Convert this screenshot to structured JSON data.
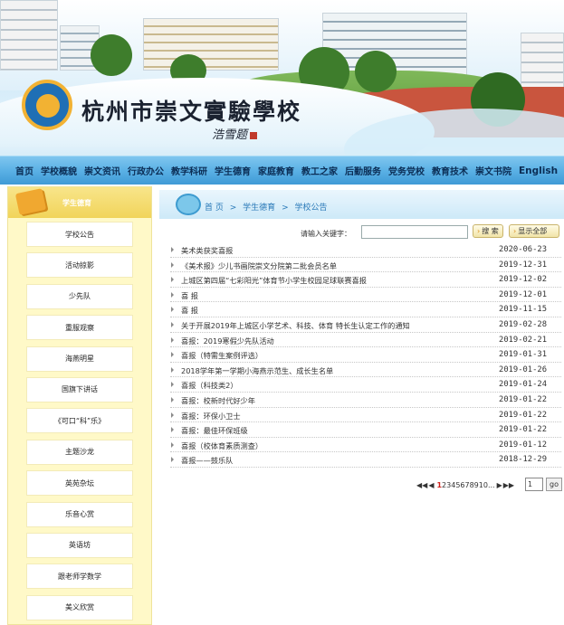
{
  "banner": {
    "school_name": "杭州市崇文實驗學校",
    "signature": "浩雪题"
  },
  "nav": {
    "items": [
      "首页",
      "学校概貌",
      "崇文资讯",
      "行政办公",
      "教学科研",
      "学生德育",
      "家庭教育",
      "教工之家",
      "后勤服务",
      "党务党校",
      "教育技术",
      "崇文书院",
      "English"
    ]
  },
  "sidebar": {
    "title": "学生德育",
    "items": [
      "学校公告",
      "活动掠影",
      "少先队",
      "重服观察",
      "海燕明星",
      "国旗下讲话",
      "《可口“科”乐》",
      "主题沙龙",
      "英苑杂坛",
      "乐音心赏",
      "英语坊",
      "跟老师学数学",
      "美义欣赏"
    ]
  },
  "breadcrumb": {
    "home": "首 页",
    "sep": ">",
    "level1": "学生德育",
    "level2": "学校公告"
  },
  "search": {
    "label": "请输入关键字：",
    "input_value": "",
    "search_button": "搜 索",
    "showall_button": "显示全部"
  },
  "news": [
    {
      "title": "美术类获奖喜报",
      "date": "2020-06-23"
    },
    {
      "title": "《美术报》少儿书画院崇文分院第二批会员名单",
      "date": "2019-12-31"
    },
    {
      "title": "上城区第四届“七彩阳光”体育节小学生校园足球联赛喜报",
      "date": "2019-12-02"
    },
    {
      "title": "喜 报",
      "date": "2019-12-01"
    },
    {
      "title": "喜 报",
      "date": "2019-11-15"
    },
    {
      "title": "关于开展2019年上城区小学艺术、科技、体育 特长生认定工作的通知",
      "date": "2019-02-28"
    },
    {
      "title": " 喜报：2019寒假少先队活动",
      "date": "2019-02-21"
    },
    {
      "title": "喜报（特需生案例评选）",
      "date": "2019-01-31"
    },
    {
      "title": "2018学年第一学期小海燕示范生、成长生名单",
      "date": "2019-01-26"
    },
    {
      "title": "喜报（科技类2）",
      "date": "2019-01-24"
    },
    {
      "title": "喜报：校新时代好少年",
      "date": "2019-01-22"
    },
    {
      "title": "喜报：环保小卫士",
      "date": "2019-01-22"
    },
    {
      "title": "喜报：最佳环保班级",
      "date": "2019-01-22"
    },
    {
      "title": "喜报（校体育素质测查）",
      "date": "2019-01-12"
    },
    {
      "title": "喜报——鼓乐队",
      "date": "2018-12-29"
    }
  ],
  "pager": {
    "first": "◀◀",
    "prev": "◀",
    "current": "1",
    "pages": "2345678910...",
    "next": "▶",
    "last": "▶▶",
    "input_value": "1",
    "go": "go"
  }
}
